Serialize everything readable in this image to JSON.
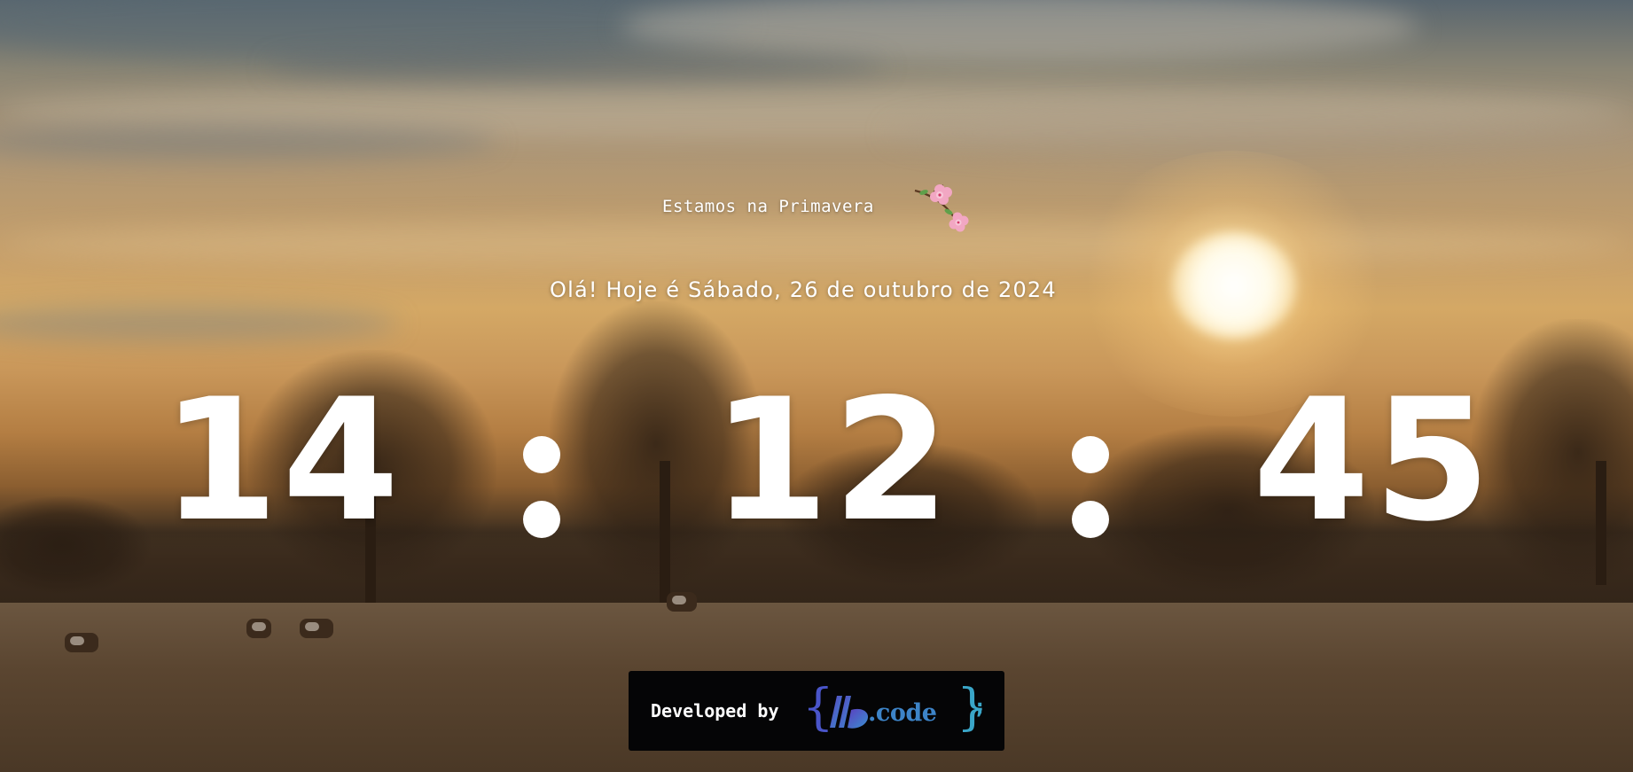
{
  "season": {
    "text": "Estamos na Primavera",
    "icon": "cherry-blossom-icon"
  },
  "greeting": "Olá! Hoje é Sábado, 26 de outubro de 2024",
  "clock": {
    "hours": "14",
    "minutes": "12",
    "seconds": "45"
  },
  "footer": {
    "developed_by": "Developed by",
    "brand": ".code",
    "brace_open": "{",
    "brace_close": "}",
    "semicolon": ";"
  },
  "colors": {
    "text": "#ffffff",
    "badge_bg": "#050506",
    "brand_blue": "#3d84c8",
    "brand_purple": "#4a55c9"
  }
}
